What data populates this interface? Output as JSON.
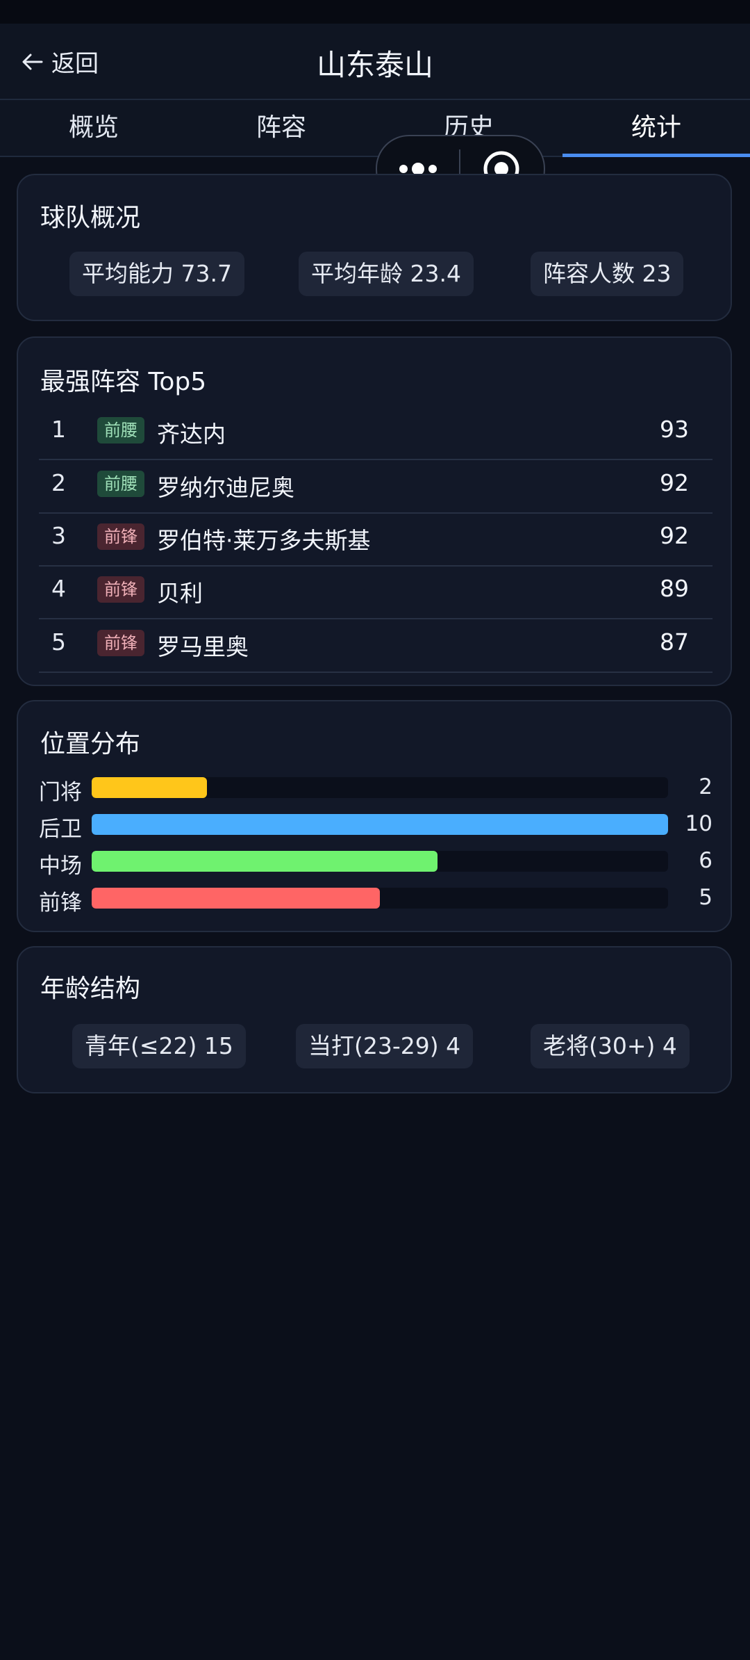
{
  "header": {
    "back_label": "返回",
    "title": "山东泰山"
  },
  "tabs": [
    {
      "label": "概览",
      "active": false
    },
    {
      "label": "阵容",
      "active": false
    },
    {
      "label": "历史",
      "active": false
    },
    {
      "label": "统计",
      "active": true
    }
  ],
  "overview": {
    "title": "球队概况",
    "chips": [
      "平均能力 73.7",
      "平均年龄 23.4",
      "阵容人数 23"
    ]
  },
  "top5": {
    "title": "最强阵容 Top5",
    "players": [
      {
        "rank": "1",
        "position": "前腰",
        "name": "齐达内",
        "score": "93"
      },
      {
        "rank": "2",
        "position": "前腰",
        "name": "罗纳尔迪尼奥",
        "score": "92"
      },
      {
        "rank": "3",
        "position": "前锋",
        "name": "罗伯特·莱万多夫斯基",
        "score": "92"
      },
      {
        "rank": "4",
        "position": "前锋",
        "name": "贝利",
        "score": "89"
      },
      {
        "rank": "5",
        "position": "前锋",
        "name": "罗马里奥",
        "score": "87"
      }
    ]
  },
  "positions": {
    "title": "位置分布",
    "max": 10,
    "items": [
      {
        "label": "门将",
        "count": 2,
        "color": "#ffc61a"
      },
      {
        "label": "后卫",
        "count": 10,
        "color": "#4aaefe"
      },
      {
        "label": "中场",
        "count": 6,
        "color": "#6ff26f"
      },
      {
        "label": "前锋",
        "count": 5,
        "color": "#ff6565"
      }
    ]
  },
  "ages": {
    "title": "年龄结构",
    "chips": [
      "青年(≤22) 15",
      "当打(23-29) 4",
      "老将(30+) 4"
    ]
  },
  "colors": {
    "accent": "#4a8df0",
    "badge_midfield_bg": "#1f4a3a",
    "badge_midfield_text": "#9fe0b8",
    "badge_forward_bg": "#4a2530",
    "badge_forward_text": "#f0b0b8"
  }
}
